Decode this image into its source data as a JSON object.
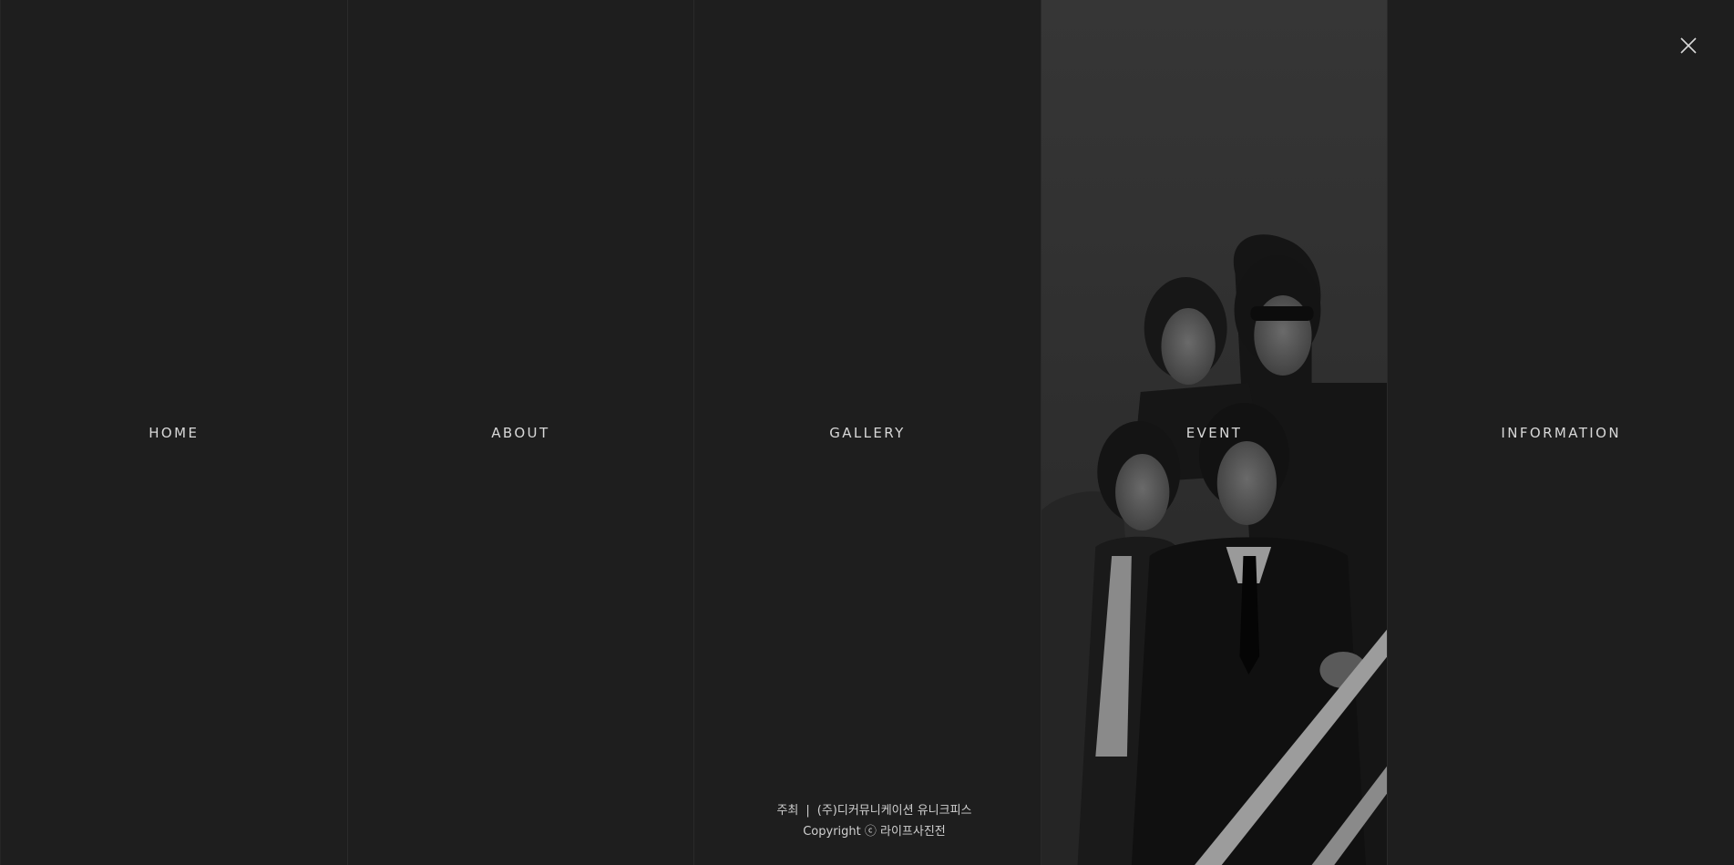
{
  "menu": {
    "items": [
      {
        "label": "HOME"
      },
      {
        "label": "ABOUT"
      },
      {
        "label": "GALLERY"
      },
      {
        "label": "EVENT"
      },
      {
        "label": "INFORMATION"
      }
    ],
    "active_index": 3
  },
  "close": {
    "icon": "close-icon"
  },
  "footer": {
    "host_label": "주최",
    "separator": "|",
    "host_name": "(주)디커뮤니케이션 유니크피스",
    "copyright": "Copyright ⓒ 라이프사진전"
  },
  "colors": {
    "background": "#1e1e1e",
    "text": "#d8d8d8",
    "panel_border": "#2a2a2a"
  }
}
